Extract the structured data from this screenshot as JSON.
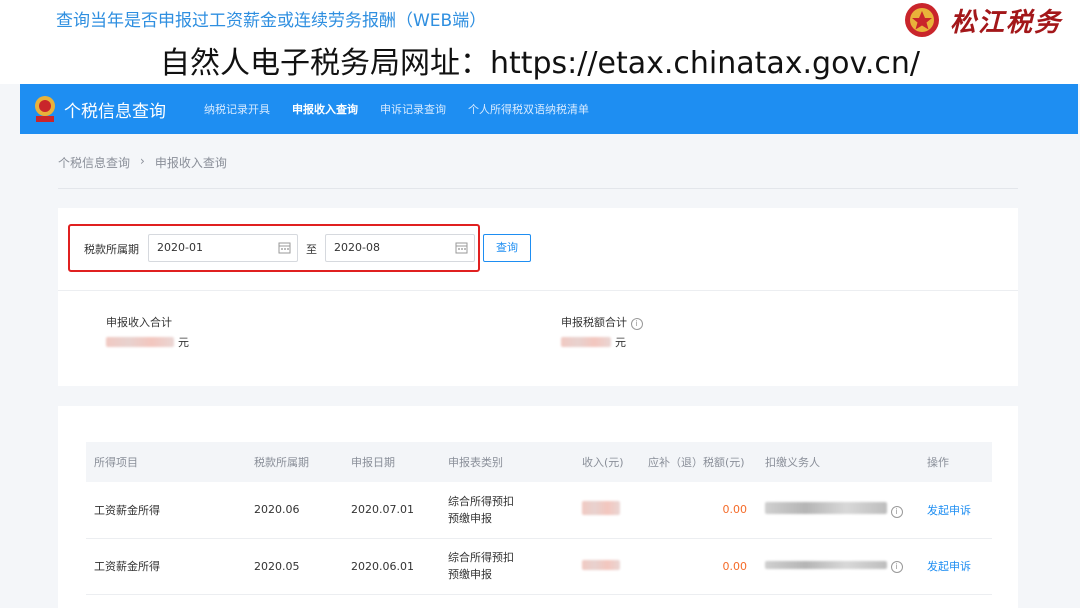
{
  "slide": {
    "title": "查询当年是否申报过工资薪金或连续劳务报酬（WEB端）",
    "url_line": "自然人电子税务局网址：https://etax.chinatax.gov.cn/",
    "brand": "松江税务"
  },
  "header": {
    "app_title": "个税信息查询",
    "nav": [
      "纳税记录开具",
      "申报收入查询",
      "申诉记录查询",
      "个人所得税双语纳税清单"
    ],
    "active_index": 1
  },
  "breadcrumb": {
    "root": "个税信息查询",
    "sep": "›",
    "current": "申报收入查询"
  },
  "query": {
    "period_label": "税款所属期",
    "start": "2020-01",
    "to_label": "至",
    "end": "2020-08",
    "button": "查询"
  },
  "summary": {
    "income_label": "申报收入合计",
    "income_unit": "元",
    "tax_label": "申报税额合计",
    "tax_unit": "元"
  },
  "table": {
    "columns": [
      "所得项目",
      "税款所属期",
      "申报日期",
      "申报表类别",
      "收入(元)",
      "应补（退）税额(元)",
      "扣缴义务人",
      "操作"
    ],
    "rows": [
      {
        "item": "工资薪金所得",
        "period": "2020.06",
        "date": "2020.07.01",
        "category_1": "综合所得预扣",
        "category_2": "预缴申报",
        "tax": "0.00",
        "action": "发起申诉"
      },
      {
        "item": "工资薪金所得",
        "period": "2020.05",
        "date": "2020.06.01",
        "category_1": "综合所得预扣",
        "category_2": "预缴申报",
        "tax": "0.00",
        "action": "发起申诉"
      }
    ]
  },
  "colors": {
    "primary": "#1e8ef2",
    "highlight": "#e02020",
    "tax_value": "#f56c2a",
    "brand": "#a3171a"
  }
}
